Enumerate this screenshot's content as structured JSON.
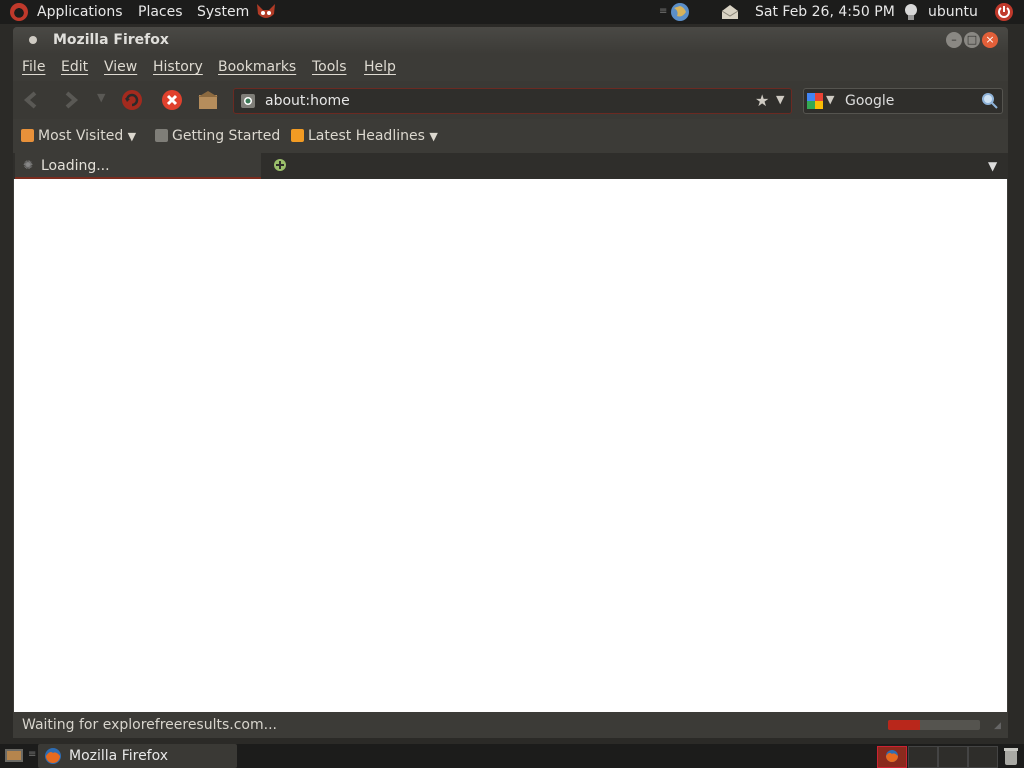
{
  "top_panel": {
    "applications": "Applications",
    "places": "Places",
    "system": "System",
    "clock": "Sat Feb 26,  4:50 PM",
    "user": "ubuntu"
  },
  "window": {
    "title": "Mozilla Firefox",
    "menu": [
      "File",
      "Edit",
      "View",
      "History",
      "Bookmarks",
      "Tools",
      "Help"
    ],
    "url": "about:home",
    "search_engine": "Google",
    "bookmarks": [
      "Most Visited",
      "Getting Started",
      "Latest Headlines"
    ],
    "tab_label": "Loading...",
    "status": "Waiting for explorefreeresults.com...",
    "progress": 0.35
  },
  "taskbar": {
    "firefox_label": "Mozilla Firefox"
  },
  "colors": {
    "panel": "#1c1c1b",
    "window": "#3c3b37",
    "accent": "#e25f39",
    "progress": "#b9271b"
  },
  "icons": [
    "ubuntu-logo-icon",
    "gimp-icon",
    "globe-icon",
    "mail-icon",
    "user-bulb-icon",
    "power-icon",
    "back-icon",
    "forward-icon",
    "reload-icon",
    "stop-icon",
    "home-icon",
    "star-icon",
    "google-icon",
    "search-icon",
    "new-tab-icon",
    "firefox-icon",
    "trash-icon"
  ]
}
